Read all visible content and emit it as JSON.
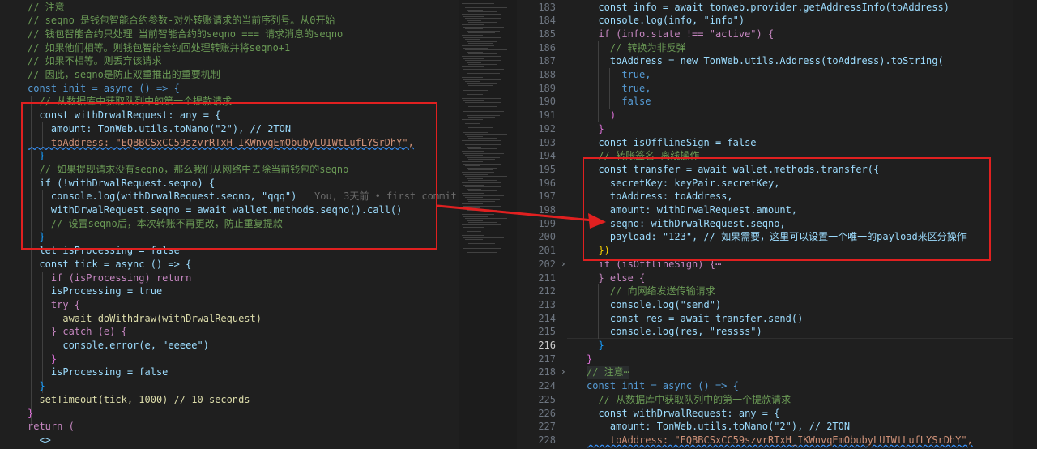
{
  "colors": {
    "annotation": "#e02020",
    "editor_bg": "#1f1f1f"
  },
  "left_editor": {
    "lines": [
      "// 注意",
      "// seqno 是钱包智能合约参数-对外转账请求的当前序列号。从0开始",
      "// 钱包智能合约只处理 当前智能合约的seqno === 请求消息的seqno",
      "// 如果他们相等。则钱包智能合约回处理转账并将seqno+1",
      "// 如果不相等。则丢弃该请求",
      "// 因此，seqno是防止双重推出的重要机制",
      "const init = async () => {",
      "  // 从数据库中获取队列中的第一个提款请求",
      "  const withDrwalRequest: any = {",
      "    amount: TonWeb.utils.toNano(\"2\"), // 2TON",
      "    toAddress: \"EQBBCSxCC59szvrRTxH_IKWnvqEmObubyLUIWtLufLYSrDhY\",",
      "  }",
      "  // 如果提现请求没有seqno，那么我们从网络中去除当前钱包的seqno",
      "  if (!withDrwalRequest.seqno) {",
      "    console.log(withDrwalRequest.seqno, \"qqq\")",
      "    withDrwalRequest.seqno = await wallet.methods.seqno().call()",
      "    // 设置seqno后，本次转账不再更改，防止重复提款",
      "  }",
      "  let isProcessing = false",
      "  const tick = async () => {",
      "    if (isProcessing) return",
      "    isProcessing = true",
      "    try {",
      "      await doWithdraw(withDrwalRequest)",
      "    } catch (e) {",
      "      console.error(e, \"eeeee\")",
      "    }",
      "    isProcessing = false",
      "  }",
      "  setTimeout(tick, 1000) // 10 seconds",
      "}",
      "return (",
      "  <>"
    ],
    "blame": "You, 3天前 • first commit"
  },
  "right_editor": {
    "line_numbers": [
      "183",
      "184",
      "185",
      "186",
      "187",
      "188",
      "189",
      "190",
      "191",
      "192",
      "193",
      "194",
      "195",
      "196",
      "197",
      "198",
      "199",
      "200",
      "201",
      "202",
      "211",
      "212",
      "213",
      "214",
      "215",
      "216",
      "217",
      "218",
      "224",
      "225",
      "226",
      "227",
      "228"
    ],
    "active_line": "216",
    "lines": [
      "  const info = await tonweb.provider.getAddressInfo(toAddress)",
      "  console.log(info, \"info\")",
      "  if (info.state !== \"active\") {",
      "    // 转换为非反弹",
      "    toAddress = new TonWeb.utils.Address(toAddress).toString(",
      "      true,",
      "      true,",
      "      false",
      "    )",
      "  }",
      "  const isOfflineSign = false",
      "  // 转账签名 离线操作",
      "  const transfer = await wallet.methods.transfer({",
      "    secretKey: keyPair.secretKey,",
      "    toAddress: toAddress,",
      "    amount: withDrwalRequest.amount,",
      "    seqno: withDrwalRequest.seqno,",
      "    payload: \"123\", // 如果需要，这里可以设置一个唯一的payload来区分操作",
      "  })",
      "  if (isOfflineSign) {⋯",
      "  } else {",
      "    // 向网络发送传输请求",
      "    console.log(\"send\")",
      "    const res = await transfer.send()",
      "    console.log(res, \"ressss\")",
      "  }",
      "}",
      "// 注意⋯",
      "const init = async () => {",
      "  // 从数据库中获取队列中的第一个提款请求",
      "  const withDrwalRequest: any = {",
      "    amount: TonWeb.utils.toNano(\"2\"), // 2TON",
      "    toAddress: \"EQBBCSxCC59szvrRTxH_IKWnvqEmObubyLUIWtLufLYSrDhY\","
    ]
  }
}
